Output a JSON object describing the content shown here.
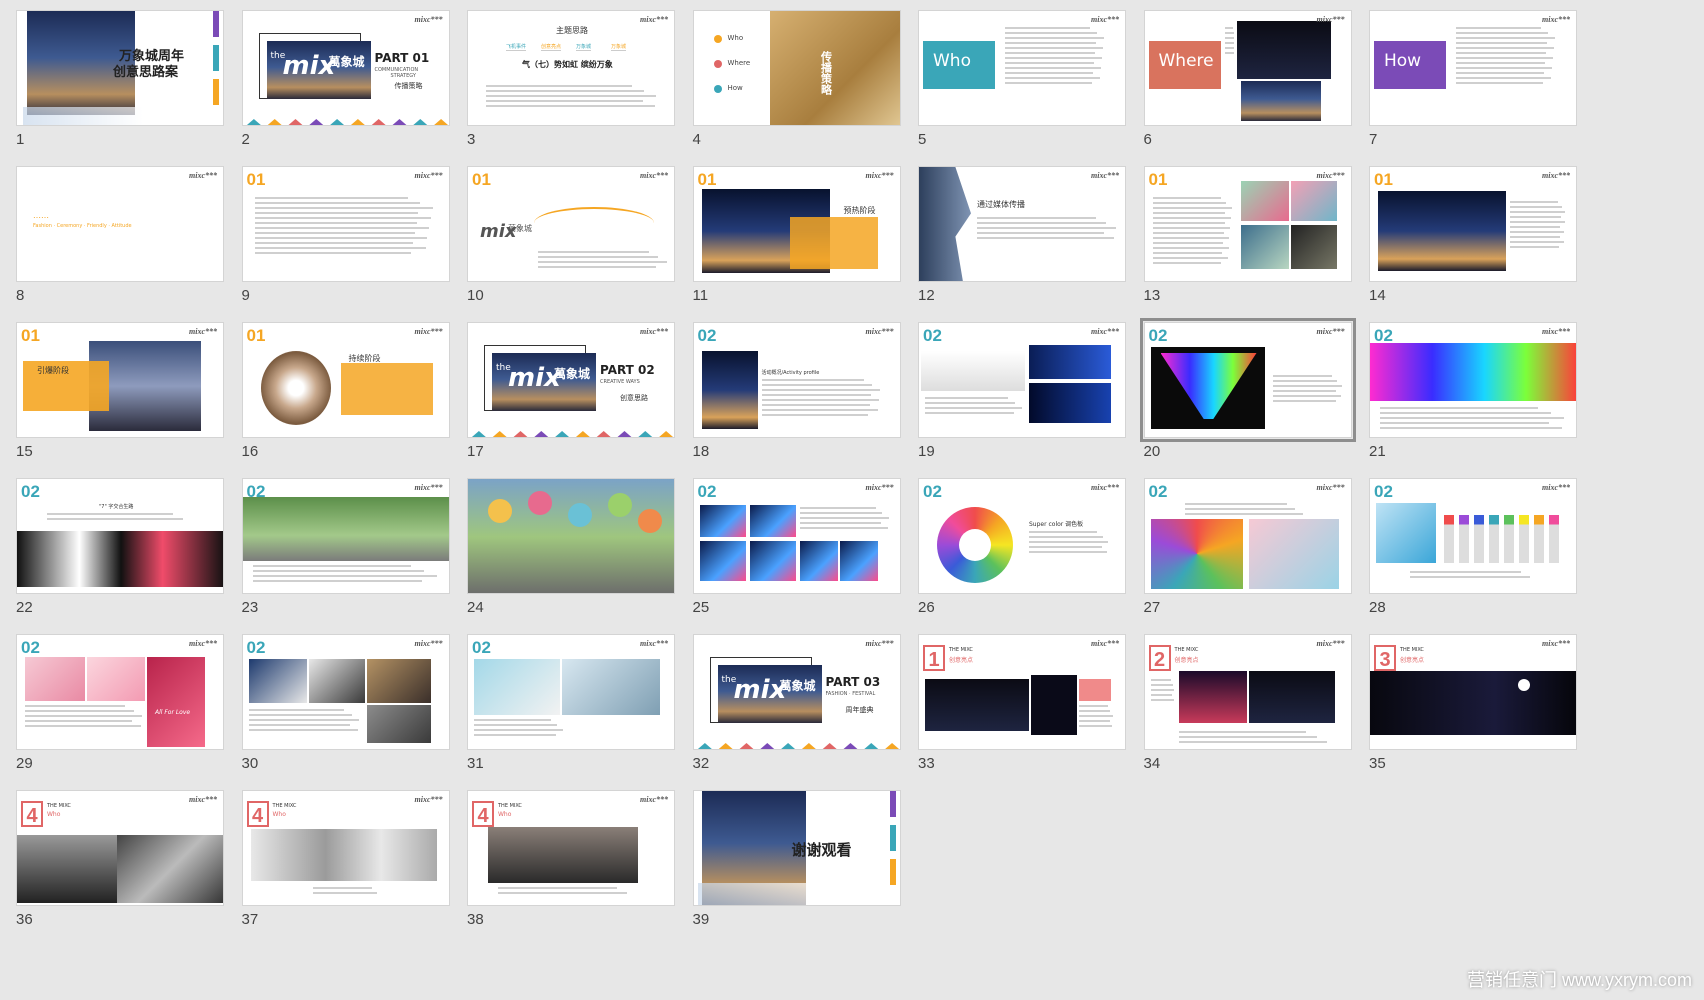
{
  "watermark": "营销任意门 www.yxrym.com",
  "colors": {
    "teal": "#3aa6b8",
    "orange": "#f5a623",
    "pink": "#e06666",
    "purple": "#7b4bb7",
    "gold": "#caa357"
  },
  "slides": [
    {
      "n": "1",
      "kind": "cover",
      "title": "万象城周年",
      "title2": "创意思路案"
    },
    {
      "n": "2",
      "kind": "part",
      "part": "PART 01",
      "sub": "COMMUNICATION",
      "sub2": "STRATEGY",
      "cn": "传播策略",
      "brand": "萬象城"
    },
    {
      "n": "3",
      "kind": "theme",
      "title": "主题思路",
      "line": "气（七）势如虹 缤纷万象",
      "flow": [
        "飞机事件",
        "创意亮点",
        "万象城",
        "万象城"
      ]
    },
    {
      "n": "4",
      "kind": "who",
      "items": [
        "Who",
        "Where",
        "How"
      ],
      "cn": "传播策略"
    },
    {
      "n": "5",
      "kind": "word",
      "word": "Who",
      "wordcolor": "#3aa6b8"
    },
    {
      "n": "6",
      "kind": "word",
      "word": "Where",
      "wordcolor": "#d9735e"
    },
    {
      "n": "7",
      "kind": "word",
      "word": "How",
      "wordcolor": "#7b4bb7"
    },
    {
      "n": "8",
      "kind": "blank",
      "tag": "Fashion · Ceremony · Friendly · Attitude"
    },
    {
      "n": "9",
      "kind": "text",
      "num": "01"
    },
    {
      "n": "10",
      "kind": "wave",
      "num": "01",
      "brand": "萬象城"
    },
    {
      "n": "11",
      "kind": "photo",
      "num": "01",
      "label": "预热阶段"
    },
    {
      "n": "12",
      "kind": "face",
      "label": "通过媒体传播"
    },
    {
      "n": "13",
      "kind": "collage",
      "num": "01"
    },
    {
      "n": "14",
      "kind": "night",
      "num": "01"
    },
    {
      "n": "15",
      "kind": "stage",
      "num": "01",
      "label": "引爆阶段"
    },
    {
      "n": "16",
      "kind": "plates",
      "num": "01",
      "label": "持续阶段"
    },
    {
      "n": "17",
      "kind": "part",
      "part": "PART 02",
      "sub": "CREATIVE WAYS",
      "sub2": "",
      "cn": "创意思路",
      "brand": "萬象城"
    },
    {
      "n": "18",
      "kind": "profile",
      "num": "02",
      "label": "活动概况/Activity profile"
    },
    {
      "n": "19",
      "kind": "plane",
      "num": "02"
    },
    {
      "n": "20",
      "kind": "rainbow",
      "num": "02",
      "selected": true
    },
    {
      "n": "21",
      "kind": "neon",
      "num": "02"
    },
    {
      "n": "22",
      "kind": "spiral",
      "num": "02"
    },
    {
      "n": "23",
      "kind": "garden",
      "num": "02"
    },
    {
      "n": "24",
      "kind": "balloons"
    },
    {
      "n": "25",
      "kind": "grid",
      "num": "02"
    },
    {
      "n": "26",
      "kind": "wheel",
      "num": "02",
      "label": "Super color 调色板"
    },
    {
      "n": "27",
      "kind": "colorful",
      "num": "02"
    },
    {
      "n": "28",
      "kind": "bottles",
      "num": "02"
    },
    {
      "n": "29",
      "kind": "pink",
      "num": "02",
      "label": "All For Love"
    },
    {
      "n": "30",
      "kind": "sports",
      "num": "02"
    },
    {
      "n": "31",
      "kind": "exhibit",
      "num": "02"
    },
    {
      "n": "32",
      "kind": "part",
      "part": "PART 03",
      "sub": "FASHION · FESTIVAL",
      "sub2": "",
      "cn": "周年盛典",
      "brand": "萬象城"
    },
    {
      "n": "33",
      "kind": "boxed",
      "box": "1",
      "title": "THE MIXC",
      "sub": "创意亮点"
    },
    {
      "n": "34",
      "kind": "boxed",
      "box": "2",
      "title": "THE MIXC",
      "sub": "创意亮点"
    },
    {
      "n": "35",
      "kind": "boxed",
      "box": "3",
      "title": "THE MIXC",
      "sub": "创意亮点"
    },
    {
      "n": "36",
      "kind": "boxed",
      "box": "4",
      "title": "THE MIXC",
      "sub": "Who"
    },
    {
      "n": "37",
      "kind": "boxed",
      "box": "4",
      "title": "THE MIXC",
      "sub": "Who"
    },
    {
      "n": "38",
      "kind": "boxed",
      "box": "4",
      "title": "THE MIXC",
      "sub": "Who"
    },
    {
      "n": "39",
      "kind": "end",
      "title": "谢谢观看"
    }
  ]
}
